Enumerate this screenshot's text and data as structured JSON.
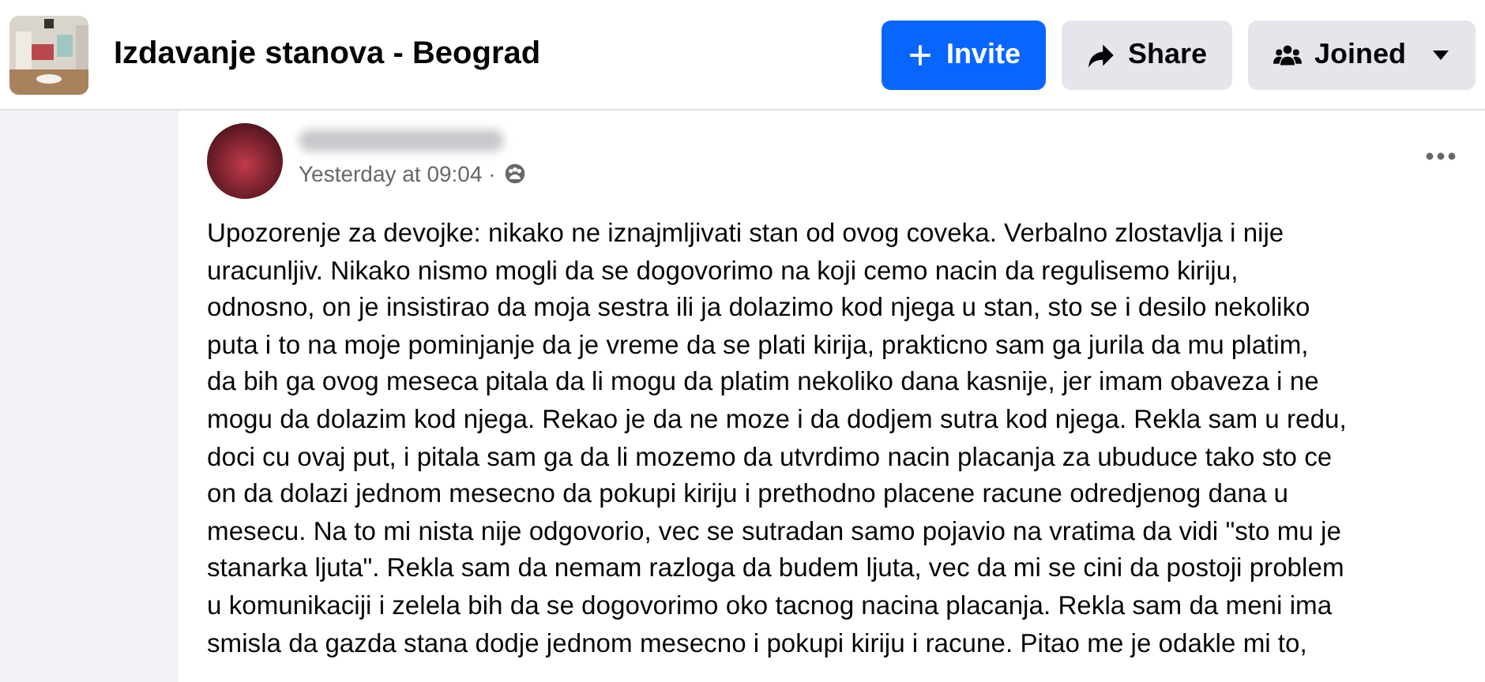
{
  "header": {
    "group_name": "Izdavanje stanova - Beograd",
    "buttons": [
      {
        "kind": "invite",
        "label": "Invite"
      },
      {
        "kind": "share",
        "label": "Share"
      },
      {
        "kind": "joined",
        "label": "Joined"
      }
    ]
  },
  "post": {
    "time": "Yesterday at 09:04 ·",
    "body_lines": [
      "Upozorenje za devojke: nikako ne iznajmljivati stan od ovog coveka. Verbalno zlostavlja i nije",
      "uracunljiv. Nikako nismo mogli da se dogovorimo na koji cemo nacin da regulisemo kiriju,",
      "odnosno, on je insistirao da moja sestra ili ja dolazimo kod njega u stan, sto se i desilo nekoliko",
      "puta i to na moje pominjanje da je vreme da se plati kirija, prakticno sam ga jurila da mu platim,",
      "da bih ga ovog meseca pitala da li mogu da platim nekoliko dana kasnije, jer imam obaveza i ne",
      "mogu da dolazim kod njega. Rekao je da ne moze i da dodjem sutra kod njega. Rekla sam u redu,",
      "doci cu ovaj put, i pitala sam ga da li mozemo da utvrdimo nacin placanja za ubuduce tako sto ce",
      "on da dolazi jednom mesecno da pokupi kiriju i prethodno placene racune odredjenog dana u",
      "mesecu. Na to mi nista nije odgovorio, vec se sutradan samo pojavio na vratima da vidi \"sto mu je",
      "stanarka ljuta\". Rekla sam da nemam razloga da budem ljuta, vec da mi se cini da postoji problem",
      "u komunikaciji i zelela bih da se dogovorimo oko tacnog nacina placanja. Rekla sam da meni ima",
      "smisla da gazda stana dodje jednom mesecno i pokupi kiriju i racune. Pitao me je odakle mi to,"
    ]
  }
}
